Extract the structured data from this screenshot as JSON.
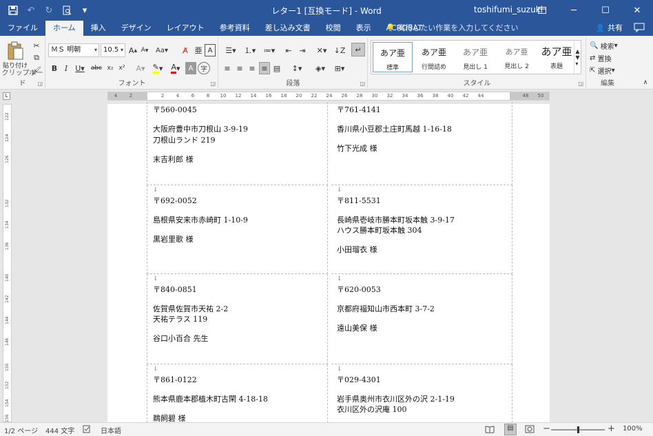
{
  "titlebar": {
    "title": "レター1 [互換モード] - Word",
    "user": "toshifumi_suzuki"
  },
  "tabs": [
    "ファイル",
    "ホーム",
    "挿入",
    "デザイン",
    "レイアウト",
    "参考資料",
    "差し込み文書",
    "校閲",
    "表示",
    "ACROBAT"
  ],
  "tellme": "実行したい作業を入力してください",
  "share": "共有",
  "ribbon": {
    "clipboard": {
      "paste": "貼り付け",
      "label": "クリップボード"
    },
    "font": {
      "name": "ＭＳ 明朝",
      "size": "10.5",
      "label": "フォント"
    },
    "paragraph": {
      "label": "段落"
    },
    "styles": {
      "label": "スタイル",
      "items": [
        {
          "sample": "あア亜",
          "name": "標準"
        },
        {
          "sample": "あア亜",
          "name": "行間詰め"
        },
        {
          "sample": "あア亜",
          "name": "見出し 1"
        },
        {
          "sample": "あア亜",
          "name": "見出し 2"
        },
        {
          "sample": "あア亜",
          "name": "表題"
        }
      ]
    },
    "editing": {
      "label": "編集",
      "find": "検索",
      "replace": "置換",
      "select": "選択"
    }
  },
  "ruler": {
    "numbers": [
      "4",
      "2",
      "2",
      "4",
      "6",
      "8",
      "10",
      "12",
      "14",
      "16",
      "18",
      "20",
      "22",
      "24",
      "26",
      "28",
      "30",
      "32",
      "34",
      "36",
      "38",
      "40",
      "42",
      "44",
      "48",
      "50"
    ],
    "vnumbers": [
      "122",
      "124",
      "126",
      "132",
      "134",
      "136",
      "140",
      "142",
      "144",
      "146",
      "150",
      "152",
      "154",
      "156"
    ]
  },
  "labels": [
    {
      "zip": "〒560-0045",
      "addr1": "大阪府豊中市刀根山 3-9-19",
      "addr2": "刀根山ランド 219",
      "name": "末吉利郎  様"
    },
    {
      "zip": "〒761-4141",
      "addr1": "香川県小豆郡土庄町馬越 1-16-18",
      "addr2": "",
      "name": "竹下光成  様"
    },
    {
      "zip": "〒692-0052",
      "addr1": "島根県安来市赤崎町 1-10-9",
      "addr2": "",
      "name": "黒岩里歌  様"
    },
    {
      "zip": "〒811-5531",
      "addr1": "長崎県壱岐市勝本町坂本触 3-9-17",
      "addr2": "ハウス勝本町坂本触 304",
      "name": "小田瑠衣  様"
    },
    {
      "zip": "〒840-0851",
      "addr1": "佐賀県佐賀市天祐 2-2",
      "addr2": "天祐テラス 119",
      "name": "谷口小百合  先生"
    },
    {
      "zip": "〒620-0053",
      "addr1": "京都府福知山市西本町 3-7-2",
      "addr2": "",
      "name": "遠山美保  様"
    },
    {
      "zip": "〒861-0122",
      "addr1": "熊本県鹿本郡植木町古閑 4-18-18",
      "addr2": "",
      "name": "鵜飼碧  様"
    },
    {
      "zip": "〒029-4301",
      "addr1": "岩手県奥州市衣川区外の沢 2-1-19",
      "addr2": "衣川区外の沢庵 100",
      "name": ""
    }
  ],
  "status": {
    "page": "1/2 ページ",
    "words": "444 文字",
    "lang": "日本語",
    "zoom": "100%"
  }
}
